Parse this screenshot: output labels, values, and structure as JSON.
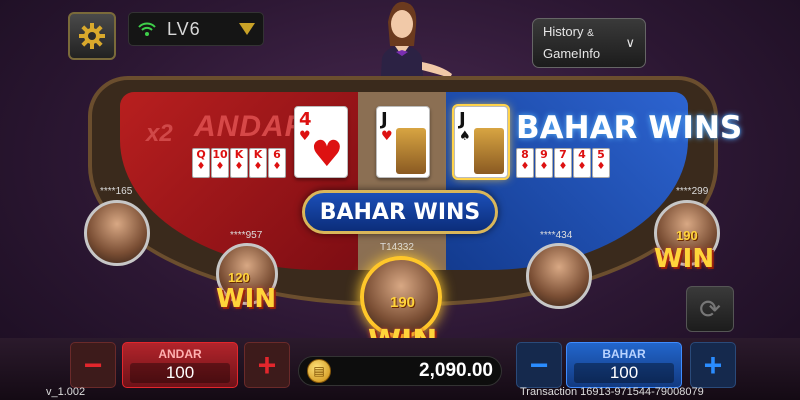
{
  "top_bar": {
    "level_label": "LV6",
    "history_line1": "History",
    "history_amp": "&",
    "history_line2": "GameInfo"
  },
  "table": {
    "andar_multiplier": "x2",
    "andar_label": "ANDAR",
    "bahar_label": "BAHAR WINS",
    "center_banner": "BAHAR WINS",
    "andar_card": {
      "rank": "4",
      "suit": "♥"
    },
    "middle_card": {
      "rank": "J",
      "suit": "♥"
    },
    "bahar_card": {
      "rank": "J",
      "suit": "♠"
    },
    "andar_small_cards": [
      {
        "rank": "Q",
        "suit": "♦",
        "color": "red"
      },
      {
        "rank": "10",
        "suit": "♦",
        "color": "red"
      },
      {
        "rank": "K",
        "suit": "♦",
        "color": "red"
      },
      {
        "rank": "K",
        "suit": "♦",
        "color": "red"
      },
      {
        "rank": "6",
        "suit": "♦",
        "color": "red"
      }
    ],
    "bahar_small_cards": [
      {
        "rank": "8",
        "suit": "♦",
        "color": "red"
      },
      {
        "rank": "9",
        "suit": "♦",
        "color": "red"
      },
      {
        "rank": "7",
        "suit": "♦",
        "color": "red"
      },
      {
        "rank": "4",
        "suit": "♦",
        "color": "red"
      },
      {
        "rank": "5",
        "suit": "♦",
        "color": "red"
      }
    ]
  },
  "players": {
    "p1": {
      "name": "****165"
    },
    "p2": {
      "name": "****957",
      "amount": "120",
      "win": "WIN"
    },
    "p3": {
      "name": "T14332",
      "amount": "190",
      "win": "WIN"
    },
    "p4": {
      "name": "****434"
    },
    "p5": {
      "name": "****299",
      "amount": "190",
      "win": "WIN"
    }
  },
  "bottom": {
    "andar_title": "ANDAR",
    "andar_bet": "100",
    "bahar_title": "BAHAR",
    "bahar_bet": "100",
    "balance": "2,090.00",
    "version": "v_1.002",
    "transaction": "Transaction 16913-971544-79008079",
    "minus_symbol": "−",
    "plus_symbol": "+"
  },
  "colors": {
    "andar_red": "#c11b22",
    "bahar_blue": "#1f54c4",
    "win_gold": "#ffd43a"
  }
}
